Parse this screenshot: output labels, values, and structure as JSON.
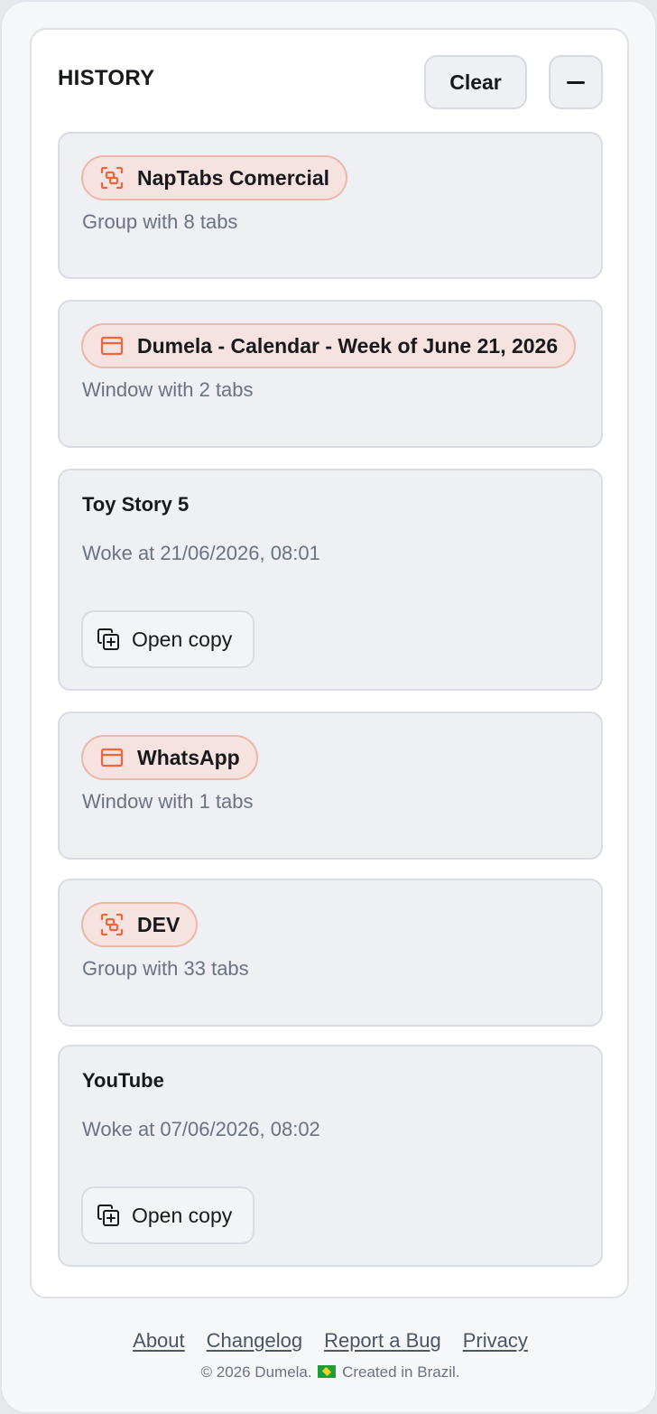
{
  "header": {
    "title": "HISTORY",
    "clear_label": "Clear",
    "minimize_icon": "minus-icon"
  },
  "cards": [
    {
      "kind": "group",
      "icon": "group-icon",
      "title": "NapTabs Comercial",
      "subtitle": "Group with 8 tabs"
    },
    {
      "kind": "window",
      "icon": "window-icon",
      "title": "Dumela - Calendar - Week of June 21, 2026",
      "subtitle": "Window with 2 tabs"
    },
    {
      "kind": "tab",
      "title": "Toy Story 5",
      "subtitle": "Woke at 21/06/2026, 08:01",
      "button": "Open copy",
      "button_icon": "copy-plus-icon"
    },
    {
      "kind": "window",
      "icon": "window-icon",
      "title": "WhatsApp",
      "subtitle": "Window with 1 tabs"
    },
    {
      "kind": "group",
      "icon": "group-icon",
      "title": "DEV",
      "subtitle": "Group with 33 tabs"
    },
    {
      "kind": "tab",
      "title": "YouTube",
      "subtitle": "Woke at 07/06/2026, 08:02",
      "button": "Open copy",
      "button_icon": "copy-plus-icon"
    }
  ],
  "footer": {
    "links": [
      "About",
      "Changelog",
      "Report a Bug",
      "Privacy"
    ],
    "copyright_prefix": "© 2026 Dumela.",
    "copyright_suffix": "Created in Brazil."
  },
  "colors": {
    "accent": "#f0643c",
    "pill_bg": "#f6e2df",
    "card_bg": "#eef0f4"
  }
}
